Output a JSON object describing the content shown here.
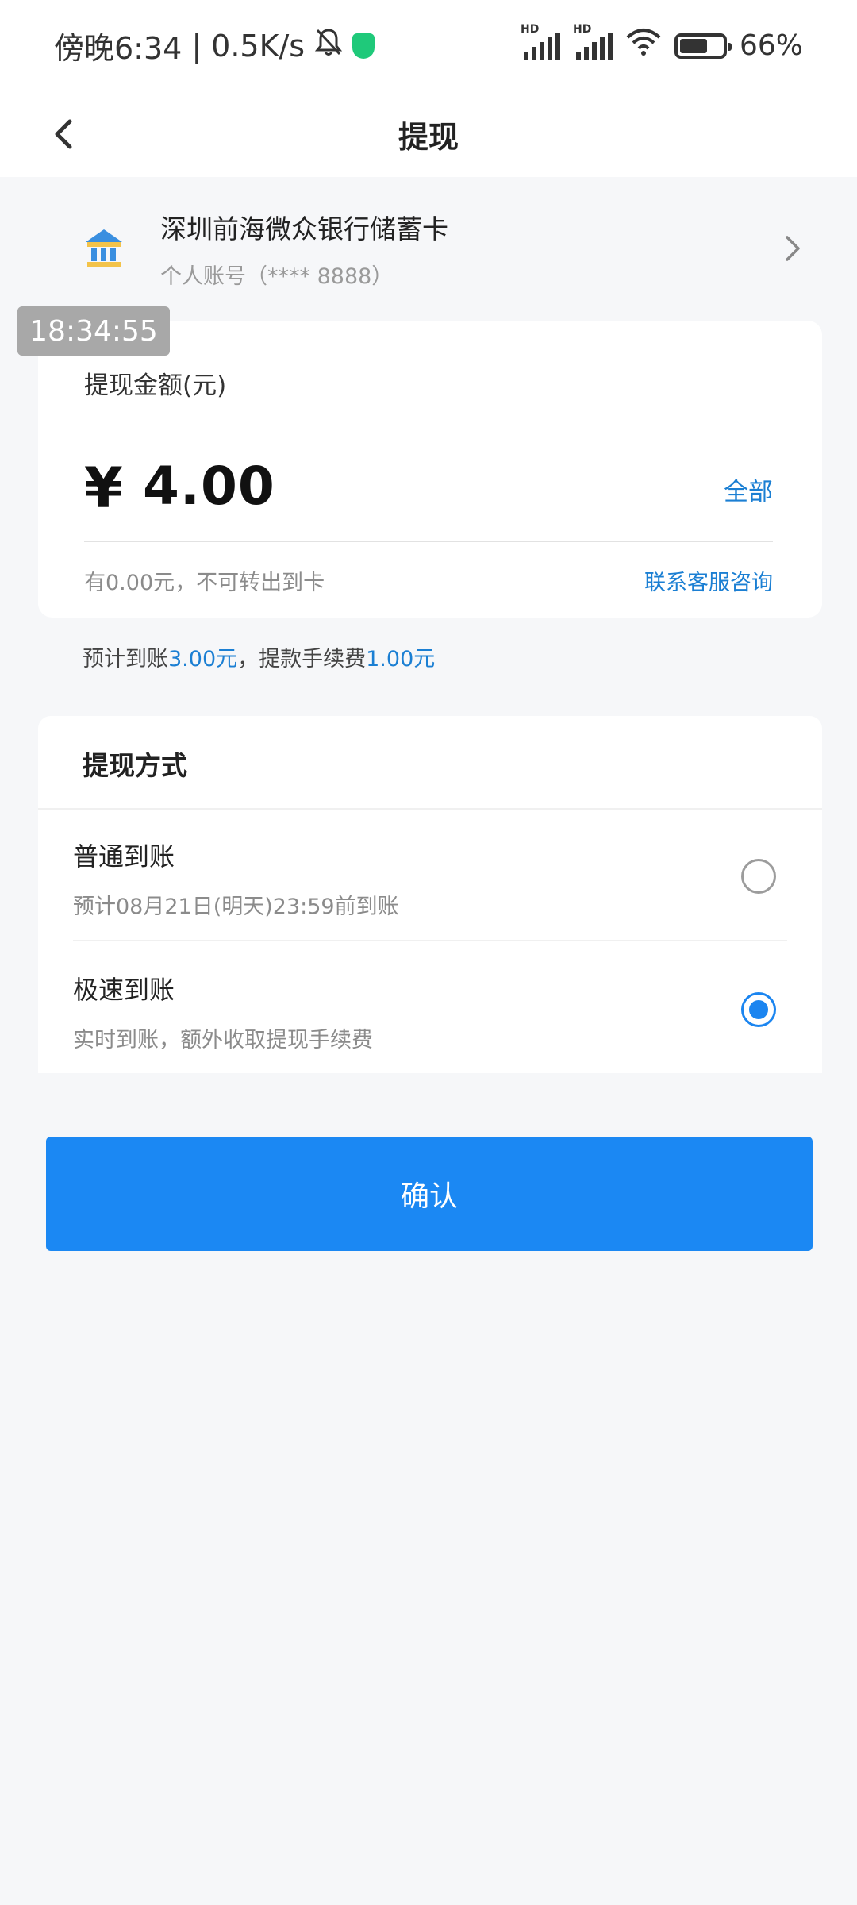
{
  "status": {
    "time_text": "傍晚6:34",
    "separator": "|",
    "speed": "0.5K/s",
    "battery": "66%",
    "battery_level": 0.66
  },
  "nav": {
    "title": "提现"
  },
  "bank": {
    "name": "深圳前海微众银行储蓄卡",
    "account": "个人账号（**** 8888）"
  },
  "overlay": {
    "timestamp": "18:34:55"
  },
  "amount": {
    "label": "提现金额(元)",
    "currency": "¥",
    "value": "4.00",
    "all_label": "全部",
    "note": "有0.00元，不可转出到卡",
    "service_link": "联系客服咨询"
  },
  "estimate": {
    "prefix": "预计到账",
    "arrive_amount": "3.00元",
    "middle": "，提款手续费",
    "fee_amount": "1.00元"
  },
  "method": {
    "title": "提现方式",
    "options": [
      {
        "name": "普通到账",
        "desc": "预计08月21日(明天)23:59前到账",
        "selected": false
      },
      {
        "name": "极速到账",
        "desc": "实时到账，额外收取提现手续费",
        "selected": true
      }
    ]
  },
  "confirm_label": "确认",
  "colors": {
    "accent": "#1b88f3",
    "link": "#1b7fd3",
    "shield": "#1fc97a"
  }
}
